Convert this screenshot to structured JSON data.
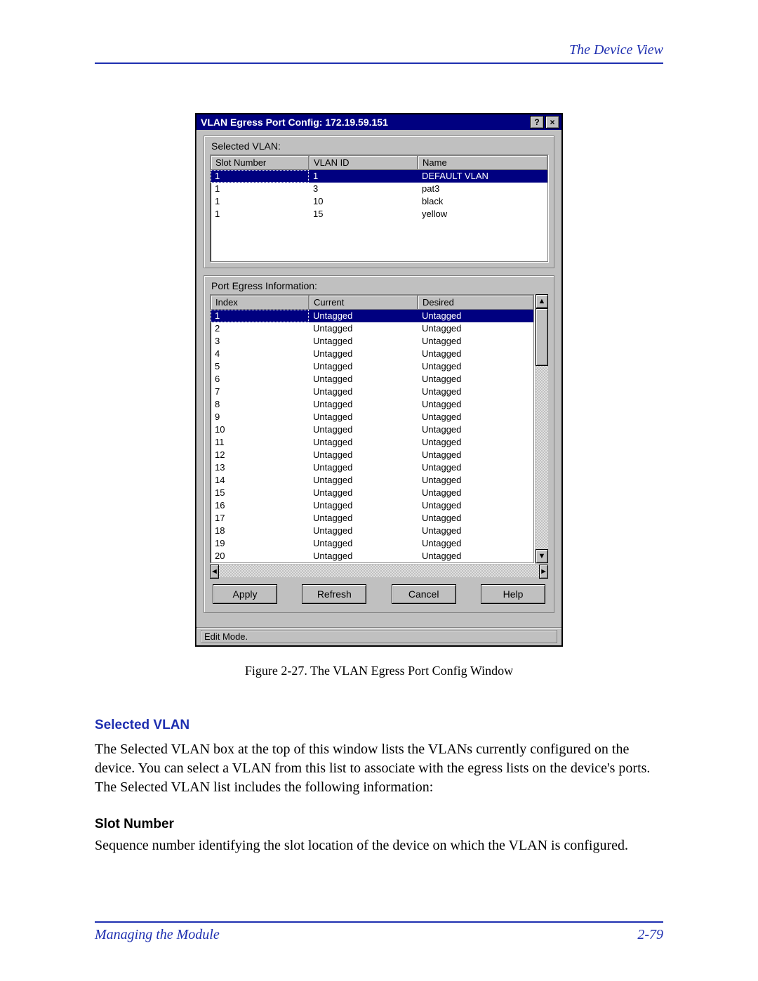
{
  "header": {
    "section": "The Device View"
  },
  "dialog": {
    "title": "VLAN Egress Port Config: 172.19.59.151",
    "help_glyph": "?",
    "close_glyph": "×",
    "group1_label": "Selected VLAN:",
    "vlan_cols": {
      "a": "Slot Number",
      "b": "VLAN ID",
      "c": "Name"
    },
    "vlans": [
      {
        "slot": "1",
        "id": "1",
        "name": "DEFAULT VLAN",
        "selected": true
      },
      {
        "slot": "1",
        "id": "3",
        "name": "pat3",
        "selected": false
      },
      {
        "slot": "1",
        "id": "10",
        "name": "black",
        "selected": false
      },
      {
        "slot": "1",
        "id": "15",
        "name": "yellow",
        "selected": false
      }
    ],
    "group2_label": "Port Egress Information:",
    "egress_cols": {
      "a": "Index",
      "b": "Current",
      "c": "Desired"
    },
    "egress": [
      {
        "index": "1",
        "current": "Untagged",
        "desired": "Untagged",
        "selected": true
      },
      {
        "index": "2",
        "current": "Untagged",
        "desired": "Untagged",
        "selected": false
      },
      {
        "index": "3",
        "current": "Untagged",
        "desired": "Untagged",
        "selected": false
      },
      {
        "index": "4",
        "current": "Untagged",
        "desired": "Untagged",
        "selected": false
      },
      {
        "index": "5",
        "current": "Untagged",
        "desired": "Untagged",
        "selected": false
      },
      {
        "index": "6",
        "current": "Untagged",
        "desired": "Untagged",
        "selected": false
      },
      {
        "index": "7",
        "current": "Untagged",
        "desired": "Untagged",
        "selected": false
      },
      {
        "index": "8",
        "current": "Untagged",
        "desired": "Untagged",
        "selected": false
      },
      {
        "index": "9",
        "current": "Untagged",
        "desired": "Untagged",
        "selected": false
      },
      {
        "index": "10",
        "current": "Untagged",
        "desired": "Untagged",
        "selected": false
      },
      {
        "index": "11",
        "current": "Untagged",
        "desired": "Untagged",
        "selected": false
      },
      {
        "index": "12",
        "current": "Untagged",
        "desired": "Untagged",
        "selected": false
      },
      {
        "index": "13",
        "current": "Untagged",
        "desired": "Untagged",
        "selected": false
      },
      {
        "index": "14",
        "current": "Untagged",
        "desired": "Untagged",
        "selected": false
      },
      {
        "index": "15",
        "current": "Untagged",
        "desired": "Untagged",
        "selected": false
      },
      {
        "index": "16",
        "current": "Untagged",
        "desired": "Untagged",
        "selected": false
      },
      {
        "index": "17",
        "current": "Untagged",
        "desired": "Untagged",
        "selected": false
      },
      {
        "index": "18",
        "current": "Untagged",
        "desired": "Untagged",
        "selected": false
      },
      {
        "index": "19",
        "current": "Untagged",
        "desired": "Untagged",
        "selected": false
      },
      {
        "index": "20",
        "current": "Untagged",
        "desired": "Untagged",
        "selected": false
      }
    ],
    "buttons": {
      "apply": "Apply",
      "refresh": "Refresh",
      "cancel": "Cancel",
      "help": "Help"
    },
    "status": "Edit Mode.",
    "arrow_up": "▲",
    "arrow_down": "▼",
    "arrow_left": "◄",
    "arrow_right": "►"
  },
  "caption": "Figure 2-27.  The VLAN Egress Port Config Window",
  "section1": {
    "head": "Selected VLAN",
    "body": "The Selected VLAN box at the top of this window lists the VLANs currently configured on the device. You can select a VLAN from this list to associate with the egress lists on the device's ports. The Selected VLAN list includes the following information:"
  },
  "section2": {
    "head": "Slot Number",
    "body": "Sequence number identifying the slot location of the device on which the VLAN is configured."
  },
  "footer": {
    "left": "Managing the Module",
    "right": "2-79"
  }
}
